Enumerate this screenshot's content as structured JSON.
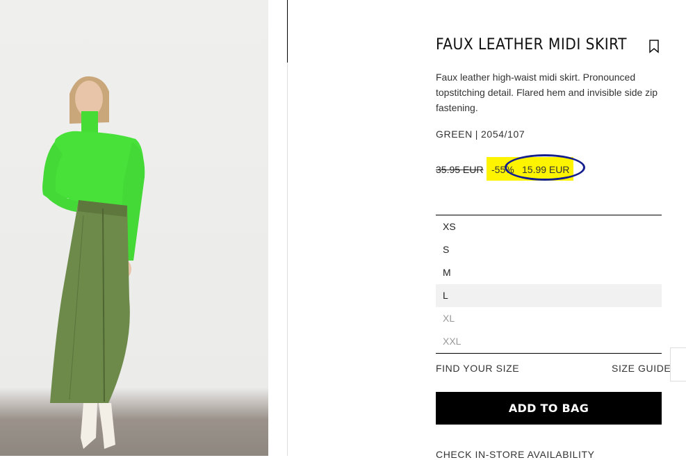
{
  "product": {
    "title": "FAUX LEATHER MIDI SKIRT",
    "description": "Faux leather high-waist midi skirt. Pronounced topstitching detail. Flared hem and invisible side zip fastening.",
    "color": "GREEN",
    "separator": "|",
    "reference": "2054/107"
  },
  "price": {
    "old": "35.95 EUR",
    "discount": "-55%",
    "new": "15.99 EUR"
  },
  "sizes": [
    {
      "label": "XS",
      "state": "available"
    },
    {
      "label": "S",
      "state": "available"
    },
    {
      "label": "M",
      "state": "available"
    },
    {
      "label": "L",
      "state": "selected"
    },
    {
      "label": "XL",
      "state": "unavailable"
    },
    {
      "label": "XXL",
      "state": "unavailable"
    }
  ],
  "links": {
    "find_size": "FIND YOUR SIZE",
    "size_guide": "SIZE GUIDE",
    "check_store": "CHECK IN-STORE AVAILABILITY"
  },
  "actions": {
    "add_to_bag": "ADD TO BAG"
  },
  "colors": {
    "sale_highlight": "#fff400",
    "annotation_circle": "#141e8c",
    "button_bg": "#000000",
    "top_color": "#44dd33",
    "skirt_color": "#6e8a4a"
  },
  "icons": {
    "bookmark": "bookmark-icon"
  }
}
